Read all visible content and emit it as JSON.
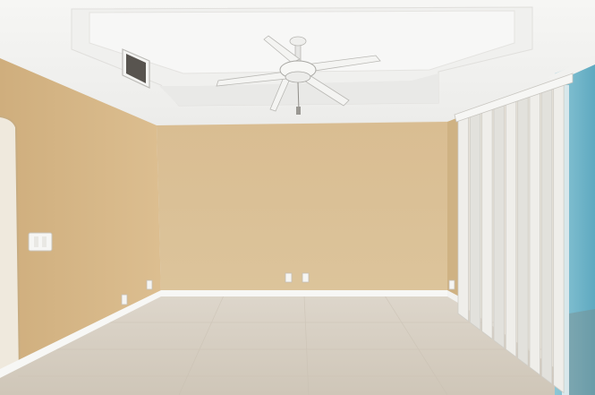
{
  "scene": {
    "kind": "empty-room-photo",
    "colors": {
      "wall_tan": "#d8bb8c",
      "wall_back": "#dcc196",
      "wall_shadow": "#c9a97a",
      "ceiling": "#f4f3f0",
      "tray_ceiling": "#eeeeec",
      "baseboard": "#f7f7f5",
      "floor": "#d9d2c6",
      "blinds": "#ecebe7",
      "window_glass": "#6fb6c9",
      "fan": "#f2f2f2"
    },
    "icons": {
      "ceiling_fan": "ceiling-fan-icon",
      "vent": "ac-vent-icon",
      "outlet": "wall-outlet-icon",
      "switch": "light-switch-icon"
    }
  }
}
